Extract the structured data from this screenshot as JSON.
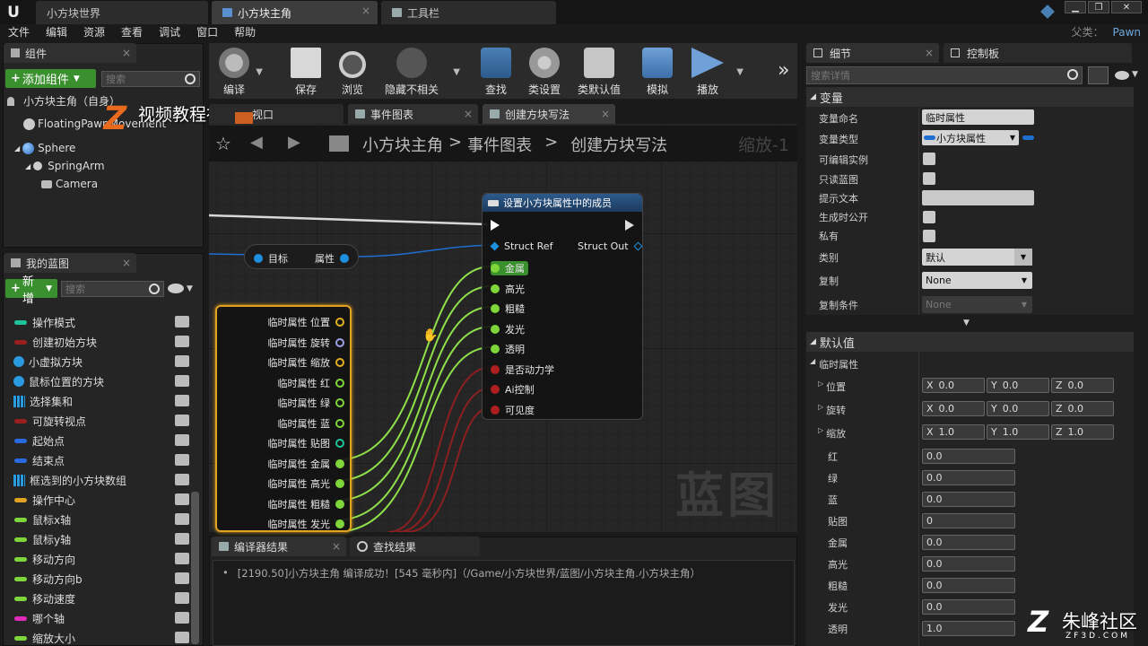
{
  "window": {
    "tabs": [
      {
        "label": "小方块世界"
      },
      {
        "label": "小方块主角"
      },
      {
        "label": "工具栏"
      }
    ],
    "parent_label": "父类：",
    "parent_value": "Pawn"
  },
  "menu": [
    "文件",
    "编辑",
    "资源",
    "查看",
    "调试",
    "窗口",
    "帮助"
  ],
  "components": {
    "tab": "组件",
    "add_button": "添加组件",
    "search_placeholder": "搜索",
    "self_label": "小方块主角（自身）",
    "items": [
      "FloatingPawnMovement",
      "Sphere",
      "SpringArm",
      "Camera"
    ]
  },
  "watermark": {
    "top": "视频教程社区",
    "top_icon": "Z",
    "bottom": "朱峰社区",
    "bottom_sub": "ZF3D.COM",
    "canvas": "蓝图"
  },
  "my_blueprint": {
    "tab": "我的蓝图",
    "new_button": "新增",
    "search_placeholder": "搜索",
    "variables": [
      {
        "name": "操作模式",
        "kind": "pill",
        "color": "#1fc49a"
      },
      {
        "name": "创建初始方块",
        "kind": "pill",
        "color": "#9a1f1f"
      },
      {
        "name": "小虚拟方块",
        "kind": "dot",
        "color": "#2a9be0"
      },
      {
        "name": "鼠标位置的方块",
        "kind": "dot",
        "color": "#2a9be0"
      },
      {
        "name": "选择集和",
        "kind": "grid",
        "color": "#2a9be0"
      },
      {
        "name": "可旋转视点",
        "kind": "pill",
        "color": "#9a1f1f"
      },
      {
        "name": "起始点",
        "kind": "pill",
        "color": "#2a6ae0"
      },
      {
        "name": "结束点",
        "kind": "pill",
        "color": "#2a6ae0"
      },
      {
        "name": "框选到的小方块数组",
        "kind": "grid",
        "color": "#2a9be0"
      },
      {
        "name": "操作中心",
        "kind": "pill",
        "color": "#e0a21f"
      },
      {
        "name": "鼠标x轴",
        "kind": "pill",
        "color": "#7ed63a"
      },
      {
        "name": "鼠标y轴",
        "kind": "pill",
        "color": "#7ed63a"
      },
      {
        "name": "移动方向",
        "kind": "pill",
        "color": "#7ed63a"
      },
      {
        "name": "移动方向b",
        "kind": "pill",
        "color": "#7ed63a"
      },
      {
        "name": "移动速度",
        "kind": "pill",
        "color": "#7ed63a"
      },
      {
        "name": "哪个轴",
        "kind": "pill",
        "color": "#e02ab9"
      },
      {
        "name": "缩放大小",
        "kind": "pill",
        "color": "#7ed63a"
      }
    ]
  },
  "toolbar": {
    "compile": "编译",
    "save": "保存",
    "browse": "浏览",
    "hide_unrelated": "隐藏不相关",
    "find": "查找",
    "class_settings": "类设置",
    "class_defaults": "类默认值",
    "simulate": "模拟",
    "play": "播放",
    "more": "»"
  },
  "graph": {
    "tabs": [
      {
        "label": "视口"
      },
      {
        "label": "事件图表"
      },
      {
        "label": "创建方块写法"
      }
    ],
    "breadcrumb": [
      "小方块主角",
      "事件图表",
      "创建方块写法"
    ],
    "breadcrumb_sep": ">",
    "zoom": "缩放-1",
    "break_node": {
      "pins": [
        {
          "label": "临时属性 位置",
          "color": "#e0b020"
        },
        {
          "label": "临时属性 旋转",
          "color": "#9aa0e8"
        },
        {
          "label": "临时属性 缩放",
          "color": "#e0b020"
        },
        {
          "label": "临时属性 红",
          "color": "#7ed63a"
        },
        {
          "label": "临时属性 绿",
          "color": "#7ed63a"
        },
        {
          "label": "临时属性 蓝",
          "color": "#7ed63a"
        },
        {
          "label": "临时属性 贴图",
          "color": "#1fc49a"
        },
        {
          "label": "临时属性 金属",
          "color": "#7ed63a"
        },
        {
          "label": "临时属性 高光",
          "color": "#7ed63a"
        },
        {
          "label": "临时属性 粗糙",
          "color": "#7ed63a"
        },
        {
          "label": "临时属性 发光",
          "color": "#7ed63a"
        }
      ]
    },
    "get_node": {
      "target": "目标",
      "property": "属性"
    },
    "set_node": {
      "title": "设置小方块属性中的成员",
      "struct_ref": "Struct Ref",
      "struct_out": "Struct Out",
      "pins": [
        {
          "label": "金属",
          "color": "#7ed63a"
        },
        {
          "label": "高光",
          "color": "#7ed63a"
        },
        {
          "label": "粗糙",
          "color": "#7ed63a"
        },
        {
          "label": "发光",
          "color": "#7ed63a"
        },
        {
          "label": "透明",
          "color": "#7ed63a"
        },
        {
          "label": "是否动力学",
          "color": "#b01f1f"
        },
        {
          "label": "Ai控制",
          "color": "#b01f1f"
        },
        {
          "label": "可见度",
          "color": "#b01f1f"
        }
      ]
    }
  },
  "bottom": {
    "tab_compiler": "编译器结果",
    "tab_find": "查找结果",
    "log": "[2190.50]小方块主角 编译成功！[545 毫秒内]（/Game/小方块世界/蓝图/小方块主角.小方块主角）"
  },
  "details": {
    "tab_details": "细节",
    "tab_palette": "控制板",
    "search_placeholder": "搜索详情",
    "section_variable": "变量",
    "var_name_label": "变量命名",
    "var_name_value": "临时属性",
    "var_type_label": "变量类型",
    "var_type_value": "小方块属性",
    "editable_label": "可编辑实例",
    "readonly_label": "只读蓝图",
    "tooltip_label": "提示文本",
    "expose_label": "生成时公开",
    "private_label": "私有",
    "category_label": "类别",
    "category_value": "默认",
    "replication_label": "复制",
    "replication_value": "None",
    "rep_cond_label": "复制条件",
    "rep_cond_value": "None",
    "section_default": "默认值",
    "struct_label": "临时属性",
    "location_label": "位置",
    "rotation_label": "旋转",
    "scale_label": "缩放",
    "location": {
      "x": "0.0",
      "y": "0.0",
      "z": "0.0"
    },
    "rotation": {
      "x": "0.0",
      "y": "0.0",
      "z": "0.0"
    },
    "scale": {
      "x": "1.0",
      "y": "1.0",
      "z": "1.0"
    },
    "scalars": [
      {
        "label": "红",
        "value": "0.0"
      },
      {
        "label": "绿",
        "value": "0.0"
      },
      {
        "label": "蓝",
        "value": "0.0"
      },
      {
        "label": "贴图",
        "value": "0"
      },
      {
        "label": "金属",
        "value": "0.0"
      },
      {
        "label": "高光",
        "value": "0.0"
      },
      {
        "label": "粗糙",
        "value": "0.0"
      },
      {
        "label": "发光",
        "value": "0.0"
      },
      {
        "label": "透明",
        "value": "1.0"
      }
    ]
  }
}
